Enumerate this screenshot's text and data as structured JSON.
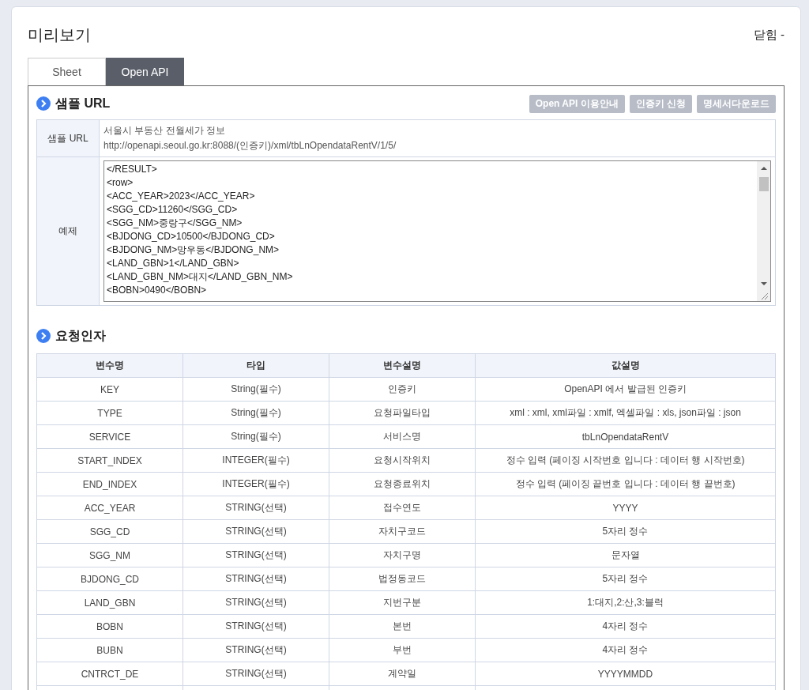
{
  "title": "미리보기",
  "close_label": "닫힘 -",
  "tabs": [
    {
      "label": "Sheet",
      "selected": false
    },
    {
      "label": "Open API",
      "selected": true
    }
  ],
  "sample_section": {
    "heading": "샘플 URL",
    "buttons": [
      "Open API 이용안내",
      "인증키 신청",
      "명세서다운로드"
    ],
    "url_label": "샘플 URL",
    "url_title": "서울시 부동산 전월세가 정보",
    "url": "http://openapi.seoul.go.kr:8088/(인증키)/xml/tbLnOpendataRentV/1/5/",
    "example_label": "예제",
    "example_lines": [
      "</RESULT>",
      "<row>",
      "<ACC_YEAR>2023</ACC_YEAR>",
      "<SGG_CD>11260</SGG_CD>",
      "<SGG_NM>중랑구</SGG_NM>",
      "<BJDONG_CD>10500</BJDONG_CD>",
      "<BJDONG_NM>망우동</BJDONG_NM>",
      "<LAND_GBN>1</LAND_GBN>",
      "<LAND_GBN_NM>대지</LAND_GBN_NM>",
      "<BOBN>0490</BOBN>"
    ]
  },
  "request_section": {
    "heading": "요청인자",
    "columns": [
      "변수명",
      "타입",
      "변수설명",
      "값설명"
    ],
    "rows": [
      [
        "KEY",
        "String(필수)",
        "인증키",
        "OpenAPI 에서 발급된 인증키"
      ],
      [
        "TYPE",
        "String(필수)",
        "요청파일타입",
        "xml : xml, xml파일 : xmlf, 엑셀파일 : xls, json파일 : json"
      ],
      [
        "SERVICE",
        "String(필수)",
        "서비스명",
        "tbLnOpendataRentV"
      ],
      [
        "START_INDEX",
        "INTEGER(필수)",
        "요청시작위치",
        "정수 입력 (페이징 시작번호 입니다 : 데이터 행 시작번호)"
      ],
      [
        "END_INDEX",
        "INTEGER(필수)",
        "요청종료위치",
        "정수 입력 (페이징 끝번호 입니다 : 데이터 행 끝번호)"
      ],
      [
        "ACC_YEAR",
        "STRING(선택)",
        "접수연도",
        "YYYY"
      ],
      [
        "SGG_CD",
        "STRING(선택)",
        "자치구코드",
        "5자리 정수"
      ],
      [
        "SGG_NM",
        "STRING(선택)",
        "자치구명",
        "문자열"
      ],
      [
        "BJDONG_CD",
        "STRING(선택)",
        "법정동코드",
        "5자리 정수"
      ],
      [
        "LAND_GBN",
        "STRING(선택)",
        "지번구분",
        "1:대지,2:산,3:블럭"
      ],
      [
        "BOBN",
        "STRING(선택)",
        "본번",
        "4자리 정수"
      ],
      [
        "BUBN",
        "STRING(선택)",
        "부번",
        "4자리 정수"
      ],
      [
        "CNTRCT_DE",
        "STRING(선택)",
        "계약일",
        "YYYYMMDD"
      ]
    ]
  }
}
